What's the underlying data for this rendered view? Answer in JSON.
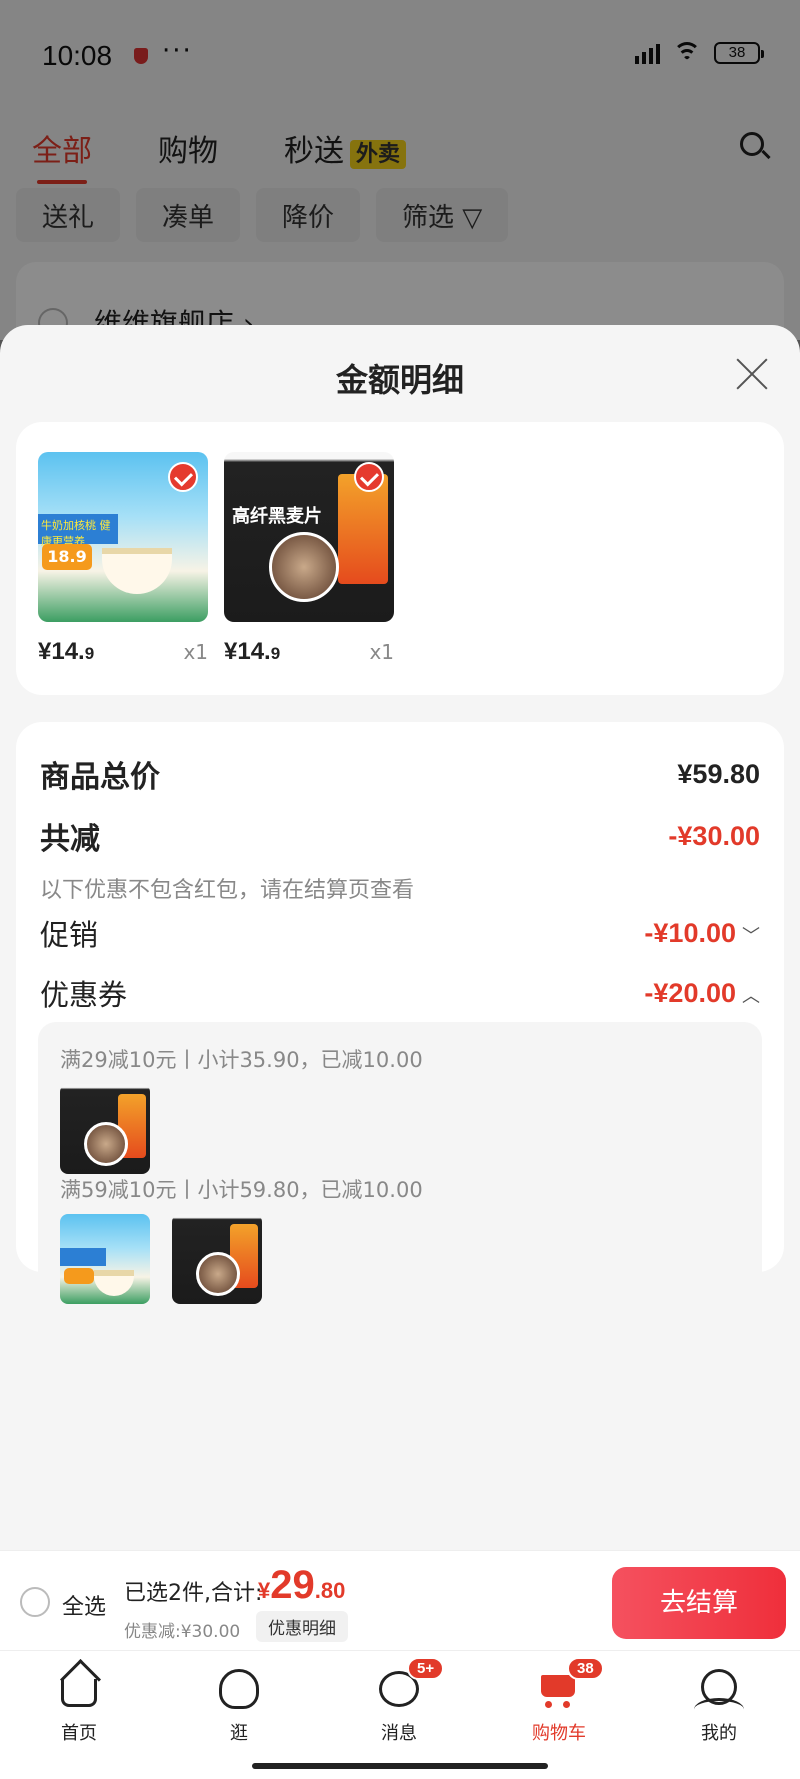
{
  "status": {
    "time": "10:08",
    "dots": "···",
    "battery": "38"
  },
  "top_tabs": [
    {
      "label": "全部"
    },
    {
      "label": "购物"
    },
    {
      "label": "秒送"
    }
  ],
  "waimai_badge": "外卖",
  "chips": [
    {
      "label": "送礼"
    },
    {
      "label": "凑单"
    },
    {
      "label": "降价"
    },
    {
      "label": "筛选 ▽"
    }
  ],
  "shop_name": "维维旗舰店 ›",
  "sheet": {
    "title": "金额明细",
    "products": [
      {
        "price_int": "¥14.",
        "price_dec": "9",
        "qty": "x1",
        "image": "oat-milk-cereal-pack"
      },
      {
        "price_int": "¥14.",
        "price_dec": "9",
        "qty": "x1",
        "image": "high-fiber-rye-cereal-pack"
      }
    ],
    "product_image_text": {
      "oat_band": "牛奶加核桃 健康更营养",
      "oat_tag": "18.9",
      "rye_label": "高纤黑麦片"
    },
    "total_label": "商品总价",
    "total_value": "¥59.80",
    "reduction_label": "共减",
    "reduction_value": "-¥30.00",
    "note": "以下优惠不包含红包，请在结算页查看",
    "promo_label": "促销",
    "promo_value": "-¥10.00",
    "coupon_label": "优惠券",
    "coupon_value": "-¥20.00",
    "coupon_lines": [
      {
        "text": "满29减10元丨小计35.90，已减10.00"
      },
      {
        "text": "满59减10元丨小计59.80，已减10.00"
      }
    ]
  },
  "summary": {
    "select_all": "全选",
    "selected_text": "已选2件,合计:",
    "total_currency": "¥",
    "total_int": "29",
    "total_dec": ".80",
    "discount_text": "优惠减:¥30.00",
    "detail_link": "优惠明细",
    "checkout": "去结算"
  },
  "tabbar": [
    {
      "label": "首页",
      "icon": "home-icon"
    },
    {
      "label": "逛",
      "icon": "browse-icon"
    },
    {
      "label": "消息",
      "icon": "message-icon",
      "badge": "5+"
    },
    {
      "label": "购物车",
      "icon": "cart-icon",
      "badge": "38"
    },
    {
      "label": "我的",
      "icon": "profile-icon"
    }
  ],
  "colors": {
    "accent": "#e23a2a",
    "checkout_gradient_start": "#f5515f",
    "checkout_gradient_end": "#ef2f3b"
  }
}
